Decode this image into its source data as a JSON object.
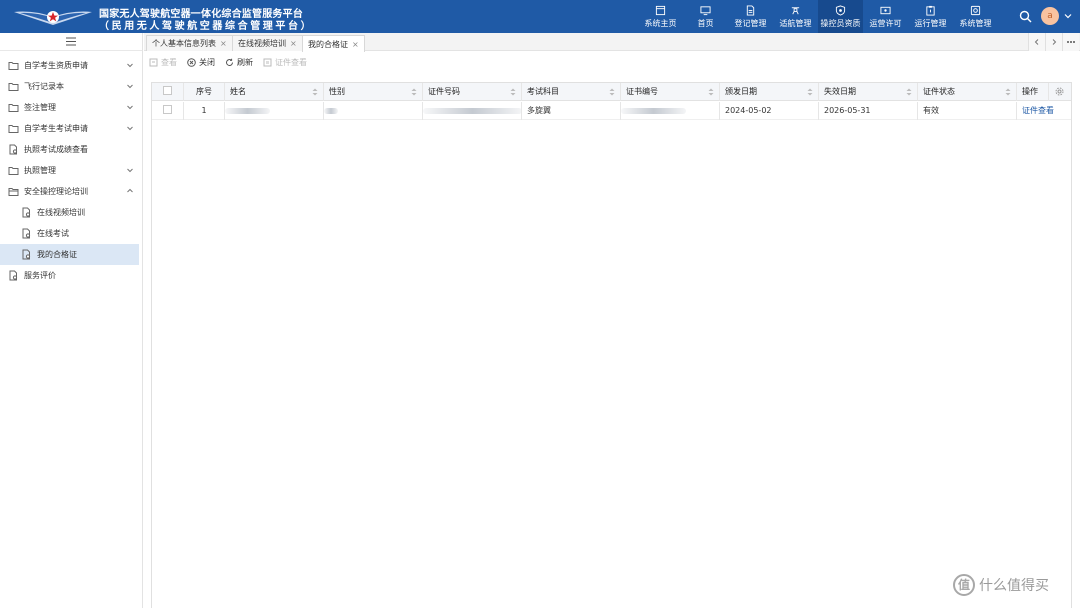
{
  "header": {
    "title_line1": "国家无人驾驶航空器一体化综合监管服务平台",
    "title_line2": "（民用无人驾驶航空器综合管理平台）",
    "nav": [
      {
        "label": "系统主页",
        "icon": "window-icon"
      },
      {
        "label": "首页",
        "icon": "monitor-icon"
      },
      {
        "label": "登记管理",
        "icon": "document-icon"
      },
      {
        "label": "适航管理",
        "icon": "drone-icon"
      },
      {
        "label": "操控员资质",
        "icon": "shield-icon",
        "active": true
      },
      {
        "label": "运营许可",
        "icon": "card-icon"
      },
      {
        "label": "运行管理",
        "icon": "clipboard-icon"
      },
      {
        "label": "系统管理",
        "icon": "settings-icon"
      }
    ],
    "avatar_text": "a"
  },
  "sidebar": {
    "items": [
      {
        "label": "自学考生资质申请",
        "expandable": true
      },
      {
        "label": "飞行记录本",
        "expandable": true
      },
      {
        "label": "签注管理",
        "expandable": true
      },
      {
        "label": "自学考生考试申请",
        "expandable": true
      },
      {
        "label": "执照考试成绩查看",
        "expandable": false
      },
      {
        "label": "执照管理",
        "expandable": true
      },
      {
        "label": "安全操控理论培训",
        "expandable": true,
        "expanded": true
      },
      {
        "label": "在线视频培训",
        "sub": true
      },
      {
        "label": "在线考试",
        "sub": true
      },
      {
        "label": "我的合格证",
        "sub": true,
        "selected": true
      },
      {
        "label": "服务评价",
        "expandable": false
      }
    ]
  },
  "tabs": [
    {
      "label": "个人基本信息列表",
      "close": "×"
    },
    {
      "label": "在线视频培训",
      "close": "×"
    },
    {
      "label": "我的合格证",
      "close": "×",
      "active": true
    }
  ],
  "toolbar": {
    "view": "查看",
    "close": "关闭",
    "refresh": "刷新",
    "cert_view": "证件查看"
  },
  "table": {
    "columns": [
      "序号",
      "姓名",
      "性别",
      "证件号码",
      "考试科目",
      "证书编号",
      "颁发日期",
      "失效日期",
      "证件状态",
      "操作"
    ],
    "rows": [
      {
        "seq": "1",
        "name": "",
        "gender": "",
        "id_no": "",
        "subject": "多旋翼",
        "cert_no": "",
        "issue_date": "2024-05-02",
        "expiry_date": "2026-05-31",
        "status": "有效",
        "action": "证件查看"
      }
    ]
  },
  "watermark": {
    "logo_text": "值",
    "text": "什么值得买"
  },
  "colors": {
    "header_bg": "#1f5aa6",
    "accent": "#1f5aa6",
    "selected_bg": "#dbe7f5"
  }
}
